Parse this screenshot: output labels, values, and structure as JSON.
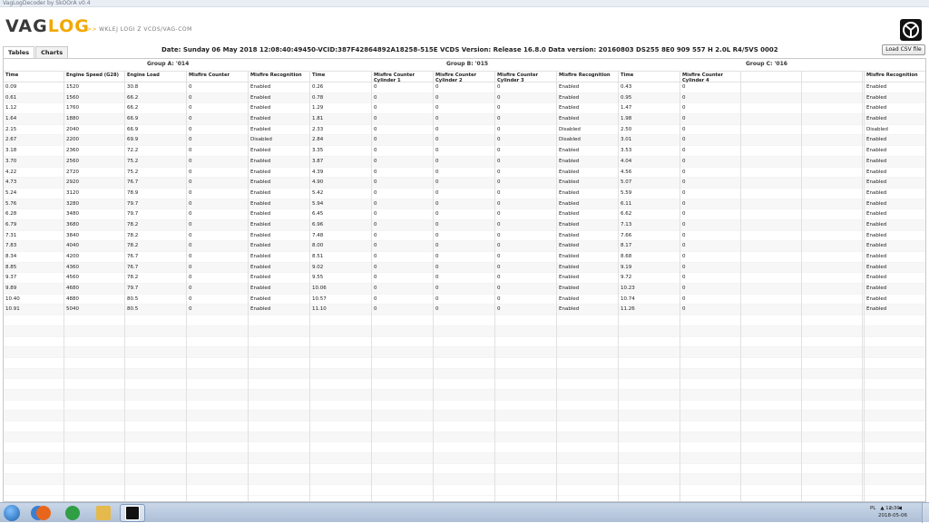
{
  "window": {
    "title": "VagLogDecoder by SkOOrA v0.4"
  },
  "app": {
    "logo_main": "VAG",
    "logo_accent": "LOG",
    "tagline_arrows": ">>",
    "tagline": "WKLEJ LOGI Z VCDS/VAG-COM"
  },
  "tabs": [
    {
      "label": "Tables",
      "active": true
    },
    {
      "label": "Charts",
      "active": false
    }
  ],
  "info": "Date: Sunday 06 May 2018 12:08:40:49450-VCID:387F42864892A18258-515E VCDS Version: Release 16.8.0 Data version: 20160803 DS255 8E0 909 557 H  2.0L R4/5VS       0002",
  "load_csv_label": "Load CSV file",
  "groups": [
    "Group A: '014",
    "Group B: '015",
    "Group C: '016"
  ],
  "columns": [
    "Time",
    "Engine Speed (G28)",
    "Engine Load",
    "Misfire Counter",
    "Misfire Recognition",
    "Time",
    "Misfire Counter Cylinder 1",
    "Misfire Counter Cylinder 2",
    "Misfire Counter Cylinder 3",
    "Misfire Recognition",
    "Time",
    "Misfire Counter Cylinder 4",
    "",
    "",
    "",
    "Misfire Recognition"
  ],
  "rows": [
    [
      "0.09",
      "1520",
      "30.8",
      "0",
      "Enabled",
      "0.26",
      "0",
      "0",
      "0",
      "Enabled",
      "0.43",
      "0",
      "",
      "",
      "",
      "Enabled"
    ],
    [
      "0.61",
      "1560",
      "66.2",
      "0",
      "Enabled",
      "0.78",
      "0",
      "0",
      "0",
      "Enabled",
      "0.95",
      "0",
      "",
      "",
      "",
      "Enabled"
    ],
    [
      "1.12",
      "1760",
      "66.2",
      "0",
      "Enabled",
      "1.29",
      "0",
      "0",
      "0",
      "Enabled",
      "1.47",
      "0",
      "",
      "",
      "",
      "Enabled"
    ],
    [
      "1.64",
      "1880",
      "66.9",
      "0",
      "Enabled",
      "1.81",
      "0",
      "0",
      "0",
      "Enabled",
      "1.98",
      "0",
      "",
      "",
      "",
      "Enabled"
    ],
    [
      "2.15",
      "2040",
      "66.9",
      "0",
      "Enabled",
      "2.33",
      "0",
      "0",
      "0",
      "Disabled",
      "2.50",
      "0",
      "",
      "",
      "",
      "Disabled"
    ],
    [
      "2.67",
      "2200",
      "69.9",
      "0",
      "Disabled",
      "2.84",
      "0",
      "0",
      "0",
      "Disabled",
      "3.01",
      "0",
      "",
      "",
      "",
      "Enabled"
    ],
    [
      "3.18",
      "2360",
      "72.2",
      "0",
      "Enabled",
      "3.35",
      "0",
      "0",
      "0",
      "Enabled",
      "3.53",
      "0",
      "",
      "",
      "",
      "Enabled"
    ],
    [
      "3.70",
      "2560",
      "75.2",
      "0",
      "Enabled",
      "3.87",
      "0",
      "0",
      "0",
      "Enabled",
      "4.04",
      "0",
      "",
      "",
      "",
      "Enabled"
    ],
    [
      "4.22",
      "2720",
      "75.2",
      "0",
      "Enabled",
      "4.39",
      "0",
      "0",
      "0",
      "Enabled",
      "4.56",
      "0",
      "",
      "",
      "",
      "Enabled"
    ],
    [
      "4.73",
      "2920",
      "76.7",
      "0",
      "Enabled",
      "4.90",
      "0",
      "0",
      "0",
      "Enabled",
      "5.07",
      "0",
      "",
      "",
      "",
      "Enabled"
    ],
    [
      "5.24",
      "3120",
      "78.9",
      "0",
      "Enabled",
      "5.42",
      "0",
      "0",
      "0",
      "Enabled",
      "5.59",
      "0",
      "",
      "",
      "",
      "Enabled"
    ],
    [
      "5.76",
      "3280",
      "79.7",
      "0",
      "Enabled",
      "5.94",
      "0",
      "0",
      "0",
      "Enabled",
      "6.11",
      "0",
      "",
      "",
      "",
      "Enabled"
    ],
    [
      "6.28",
      "3480",
      "79.7",
      "0",
      "Enabled",
      "6.45",
      "0",
      "0",
      "0",
      "Enabled",
      "6.62",
      "0",
      "",
      "",
      "",
      "Enabled"
    ],
    [
      "6.79",
      "3680",
      "78.2",
      "0",
      "Enabled",
      "6.96",
      "0",
      "0",
      "0",
      "Enabled",
      "7.13",
      "0",
      "",
      "",
      "",
      "Enabled"
    ],
    [
      "7.31",
      "3840",
      "78.2",
      "0",
      "Enabled",
      "7.48",
      "0",
      "0",
      "0",
      "Enabled",
      "7.66",
      "0",
      "",
      "",
      "",
      "Enabled"
    ],
    [
      "7.83",
      "4040",
      "78.2",
      "0",
      "Enabled",
      "8.00",
      "0",
      "0",
      "0",
      "Enabled",
      "8.17",
      "0",
      "",
      "",
      "",
      "Enabled"
    ],
    [
      "8.34",
      "4200",
      "76.7",
      "0",
      "Enabled",
      "8.51",
      "0",
      "0",
      "0",
      "Enabled",
      "8.68",
      "0",
      "",
      "",
      "",
      "Enabled"
    ],
    [
      "8.85",
      "4360",
      "76.7",
      "0",
      "Enabled",
      "9.02",
      "0",
      "0",
      "0",
      "Enabled",
      "9.19",
      "0",
      "",
      "",
      "",
      "Enabled"
    ],
    [
      "9.37",
      "4560",
      "78.2",
      "0",
      "Enabled",
      "9.55",
      "0",
      "0",
      "0",
      "Enabled",
      "9.72",
      "0",
      "",
      "",
      "",
      "Enabled"
    ],
    [
      "9.89",
      "4680",
      "79.7",
      "0",
      "Enabled",
      "10.06",
      "0",
      "0",
      "0",
      "Enabled",
      "10.23",
      "0",
      "",
      "",
      "",
      "Enabled"
    ],
    [
      "10.40",
      "4880",
      "80.5",
      "0",
      "Enabled",
      "10.57",
      "0",
      "0",
      "0",
      "Enabled",
      "10.74",
      "0",
      "",
      "",
      "",
      "Enabled"
    ],
    [
      "10.91",
      "5040",
      "80.5",
      "0",
      "Enabled",
      "11.10",
      "0",
      "0",
      "0",
      "Enabled",
      "11.26",
      "0",
      "",
      "",
      "",
      "Enabled"
    ]
  ],
  "empty_rows": 17,
  "taskbar": {
    "apps": [
      {
        "icon": "file-explorer-icon",
        "color": "#3b7fd0"
      },
      {
        "icon": "firefox-icon",
        "color": "#e8661c"
      },
      {
        "icon": "chrome-icon",
        "color": "#2f9e44"
      },
      {
        "icon": "folder-icon",
        "color": "#e5b94b"
      },
      {
        "icon": "vaglog-app-icon",
        "color": "#111111"
      }
    ],
    "language": "PL",
    "time": "12:30",
    "date": "2018-05-06"
  }
}
